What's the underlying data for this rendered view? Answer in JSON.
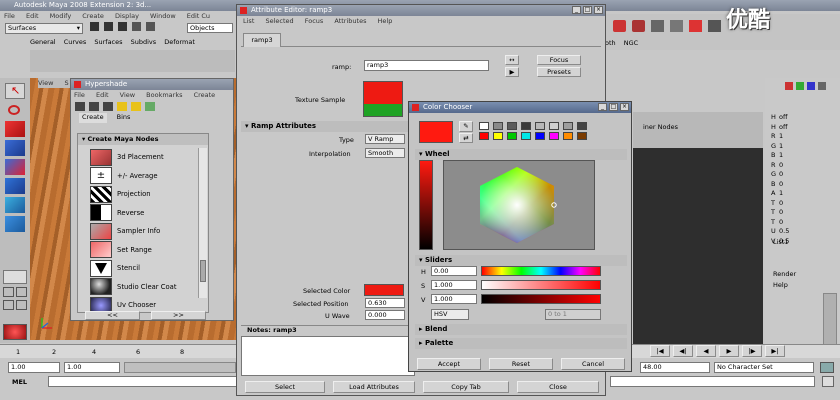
{
  "maya": {
    "title": "Autodesk Maya 2008 Extension 2: 3d...",
    "menus": [
      "File",
      "Edit",
      "Modify",
      "Create",
      "Display",
      "Window",
      "Edit Cu"
    ],
    "mode_select": "Surfaces",
    "objects_label": "Objects",
    "shelf_tabs": [
      "General",
      "Curves",
      "Surfaces",
      "Subdivs",
      "Deformat"
    ],
    "right_shelf_tabs": [
      "oth",
      "NGC"
    ],
    "viewport_menu": [
      "View",
      "S"
    ],
    "channel_values": [
      "off",
      "off",
      "1",
      "1",
      "1",
      "0",
      "0",
      "0",
      "1",
      "0",
      "0",
      "0",
      "0.5",
      "0.5"
    ],
    "channel_letters": [
      "H",
      "H",
      "R",
      "G",
      "B",
      "R",
      "G",
      "B",
      "A",
      "T",
      "T",
      "T",
      "U",
      "V"
    ],
    "right_labels": [
      "List1",
      "Render",
      "Help"
    ],
    "timeline_numbers": [
      "1",
      "2",
      "4",
      "6",
      "8"
    ],
    "range_start": "1.00",
    "range_start2": "1.00",
    "range_end_value": "48.00",
    "char_set": "No Character Set",
    "mel_label": "MEL",
    "watermark": "优酷"
  },
  "hypershade": {
    "title": "Hypershade",
    "menus": [
      "File",
      "Edit",
      "View",
      "Bookmarks",
      "Create"
    ],
    "tabs": [
      "Create",
      "Bins"
    ],
    "section": "Create Maya Nodes",
    "nodes": [
      "3d Placement",
      "+/- Average",
      "Projection",
      "Reverse",
      "Sampler Info",
      "Set Range",
      "Stencil",
      "Studio Clear Coat",
      "Uv Chooser"
    ],
    "scroll_left": "<<",
    "scroll_right": ">>"
  },
  "attribute_editor": {
    "title": "Attribute Editor: ramp3",
    "menus": [
      "List",
      "Selected",
      "Focus",
      "Attributes",
      "Help"
    ],
    "tab": "ramp3",
    "ramp_label": "ramp:",
    "ramp_value": "ramp3",
    "focus_label": "Focus",
    "presets_label": "Presets",
    "texture_sample_label": "Texture Sample",
    "ramp_section": "Ramp Attributes",
    "type_label": "Type",
    "type_value": "V Ramp",
    "interp_label": "Interpolation",
    "interp_value": "Smooth",
    "selected_color_label": "Selected Color",
    "selected_position_label": "Selected Position",
    "selected_position_value": "0.630",
    "u_wave_label": "U Wave",
    "u_wave_value": "0.000",
    "notes_label": "Notes:  ramp3",
    "buttons": [
      "Select",
      "Load Attributes",
      "Copy Tab",
      "Close"
    ],
    "colors": {
      "red": "#ee1a12",
      "green": "#1fa324"
    }
  },
  "color_chooser": {
    "title": "Color Chooser",
    "wheel_label": "Wheel",
    "sliders_label": "Sliders",
    "blend_label": "Blend",
    "palette_label": "Palette",
    "h_label": "H",
    "h_value": "0.00",
    "s_label": "S",
    "s_value": "1.000",
    "v_label": "V",
    "v_value": "1.000",
    "mode_select": "HSV",
    "range_select": "0 to 1",
    "buttons": [
      "Accept",
      "Reset",
      "Cancel"
    ],
    "current_color": "#ff1a10",
    "palette_top": [
      "#ffffff",
      "#8a8a8a",
      "#5a5a5a",
      "#3a3a3a",
      "#b7b7b7",
      "#d0d0d0",
      "#9e9e9e",
      "#444444"
    ],
    "palette_bottom": [
      "#ff0000",
      "#ffff00",
      "#00c800",
      "#00e5e5",
      "#0000ff",
      "#ff00ff",
      "#ff8c00",
      "#7a3b00"
    ]
  },
  "render_panel": {
    "tab_label": "iner Nodes"
  }
}
